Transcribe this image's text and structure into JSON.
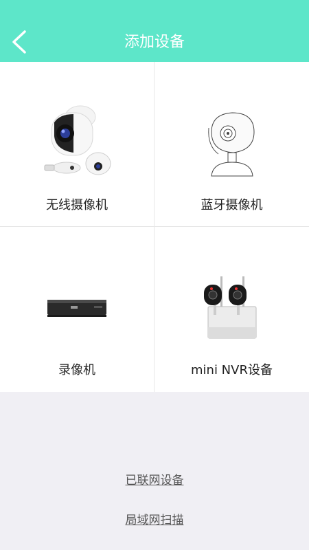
{
  "header": {
    "title": "添加设备",
    "back_icon": "chevron-left-icon",
    "color": "#5de6c9"
  },
  "devices": [
    {
      "label": "无线摄像机",
      "icon": "wireless-camera-image"
    },
    {
      "label": "蓝牙摄像机",
      "icon": "bluetooth-camera-image"
    },
    {
      "label": "录像机",
      "icon": "recorder-image"
    },
    {
      "label": "mini NVR设备",
      "icon": "mini-nvr-image"
    }
  ],
  "links": {
    "networked_devices": "已联网设备",
    "lan_scan": "局域网扫描"
  }
}
